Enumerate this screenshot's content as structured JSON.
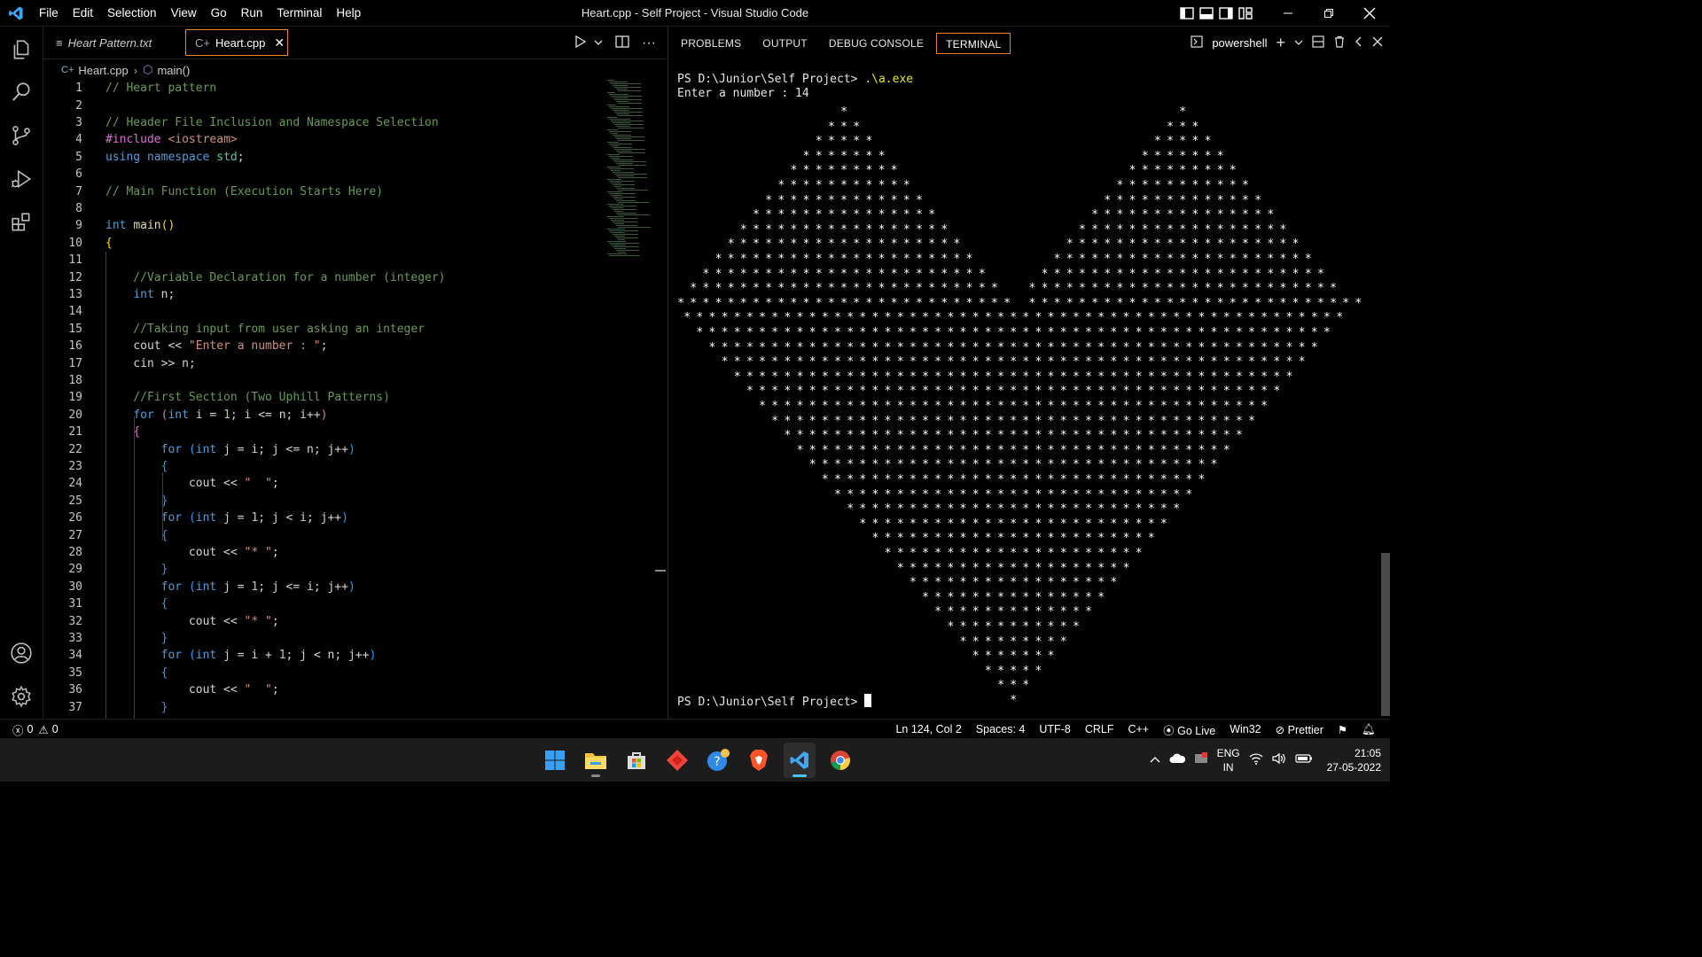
{
  "titlebar": {
    "menu": [
      "File",
      "Edit",
      "Selection",
      "View",
      "Go",
      "Run",
      "Terminal",
      "Help"
    ],
    "window_title": "Heart.cpp - Self Project - Visual Studio Code"
  },
  "tabs": [
    {
      "label": "Heart Pattern.txt",
      "icon": "list-icon",
      "active": false
    },
    {
      "label": "Heart.cpp",
      "icon": "cpp-file-icon",
      "active": true
    }
  ],
  "breadcrumb": {
    "file": "Heart.cpp",
    "symbol": "main()"
  },
  "panel": {
    "tabs": [
      "PROBLEMS",
      "OUTPUT",
      "DEBUG CONSOLE",
      "TERMINAL"
    ],
    "active_tab": "TERMINAL",
    "terminal_name": "powershell"
  },
  "terminal": {
    "prompt1": "PS D:\\Junior\\Self Project> ",
    "command": ".\\a.exe",
    "output1": "Enter a number : 14",
    "prompt2": "PS D:\\Junior\\Self Project> ",
    "n": 14
  },
  "statusbar": {
    "errors": "0",
    "warnings": "0",
    "position": "Ln 124, Col 2",
    "spaces": "Spaces: 4",
    "encoding": "UTF-8",
    "eol": "CRLF",
    "language": "C++",
    "golive": "Go Live",
    "platform": "Win32",
    "prettier": "Prettier"
  },
  "taskbar": {
    "apps": [
      "windows-start",
      "file-explorer",
      "microsoft-store",
      "anydesk",
      "get-help",
      "brave-browser",
      "vscode",
      "chrome"
    ],
    "lang1": "ENG",
    "lang2": "IN",
    "time": "21:05",
    "date": "27-05-2022"
  },
  "code": [
    {
      "n": "1",
      "t": "// Heart pattern"
    },
    {
      "n": "2",
      "t": ""
    },
    {
      "n": "3",
      "t": "// Header File Inclusion and Namespace Selection"
    },
    {
      "n": "4",
      "t": "#include <iostream>"
    },
    {
      "n": "5",
      "t": "using namespace std;"
    },
    {
      "n": "6",
      "t": ""
    },
    {
      "n": "7",
      "t": "// Main Function (Execution Starts Here)"
    },
    {
      "n": "8",
      "t": ""
    },
    {
      "n": "9",
      "t": "int main()"
    },
    {
      "n": "10",
      "t": "{"
    },
    {
      "n": "11",
      "t": ""
    },
    {
      "n": "12",
      "t": "    //Variable Declaration for a number (integer)"
    },
    {
      "n": "13",
      "t": "    int n;"
    },
    {
      "n": "14",
      "t": ""
    },
    {
      "n": "15",
      "t": "    //Taking input from user asking an integer"
    },
    {
      "n": "16",
      "t": "    cout << \"Enter a number : \";"
    },
    {
      "n": "17",
      "t": "    cin >> n;"
    },
    {
      "n": "18",
      "t": ""
    },
    {
      "n": "19",
      "t": "    //First Section (Two Uphill Patterns)"
    },
    {
      "n": "20",
      "t": "    for (int i = 1; i <= n; i++)"
    },
    {
      "n": "21",
      "t": "    {"
    },
    {
      "n": "22",
      "t": "        for (int j = i; j <= n; j++)"
    },
    {
      "n": "23",
      "t": "        {"
    },
    {
      "n": "24",
      "t": "            cout << \"  \";"
    },
    {
      "n": "25",
      "t": "        }"
    },
    {
      "n": "26",
      "t": "        for (int j = 1; j < i; j++)"
    },
    {
      "n": "27",
      "t": "        {"
    },
    {
      "n": "28",
      "t": "            cout << \"* \";"
    },
    {
      "n": "29",
      "t": "        }"
    },
    {
      "n": "30",
      "t": "        for (int j = 1; j <= i; j++)"
    },
    {
      "n": "31",
      "t": "        {"
    },
    {
      "n": "32",
      "t": "            cout << \"* \";"
    },
    {
      "n": "33",
      "t": "        }"
    },
    {
      "n": "34",
      "t": "        for (int j = i + 1; j < n; j++)"
    },
    {
      "n": "35",
      "t": "        {"
    },
    {
      "n": "36",
      "t": "            cout << \"  \";"
    },
    {
      "n": "37",
      "t": "        }"
    }
  ]
}
